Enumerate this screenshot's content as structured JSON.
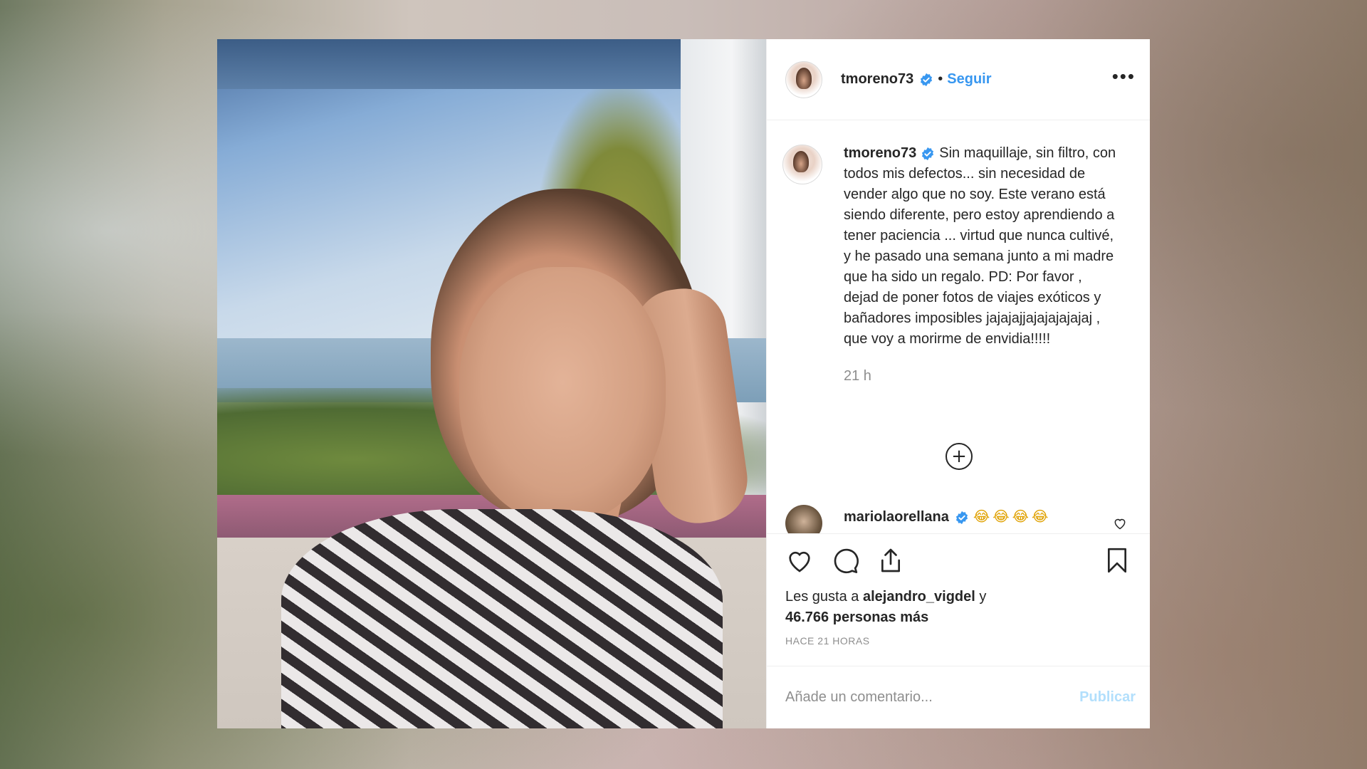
{
  "post": {
    "author": {
      "username": "tmoreno73",
      "verified": true,
      "follow_label": "Seguir",
      "separator": "•"
    },
    "more_label": "•••",
    "caption": {
      "username": "tmoreno73",
      "text": "Sin maquillaje, sin filtro, con todos mis defectos... sin necesidad de vender algo que no soy. Este verano está siendo diferente, pero estoy aprendiendo a tener paciencia ... virtud que nunca cultivé, y he pasado una semana junto a mi madre que ha sido un regalo. PD: Por favor , dejad de poner fotos de viajes exóticos y bañadores imposibles jajajajjajajajajajaj , que voy a morirme de envidia!!!!!",
      "time": "21 h"
    },
    "load_more_symbol": "+",
    "comment": {
      "username": "mariolaorellana",
      "verified": true,
      "text": "😂😂😂😂"
    },
    "likes": {
      "prefix": "Les gusta a",
      "user": "alejandro_vigdel",
      "conj": "y",
      "count": "46.766 personas más"
    },
    "posted_ago": "HACE 21 HORAS",
    "add_comment": {
      "placeholder": "Añade un comentario...",
      "publish_label": "Publicar"
    }
  },
  "colors": {
    "accent": "#3897f0",
    "publish_disabled": "#b2dffc",
    "text": "#262626",
    "muted": "#8e8e8e"
  },
  "icons": [
    "verified-badge-icon",
    "more-options-icon",
    "plus-circle-icon",
    "heart-icon",
    "comment-icon",
    "share-icon",
    "bookmark-icon"
  ]
}
